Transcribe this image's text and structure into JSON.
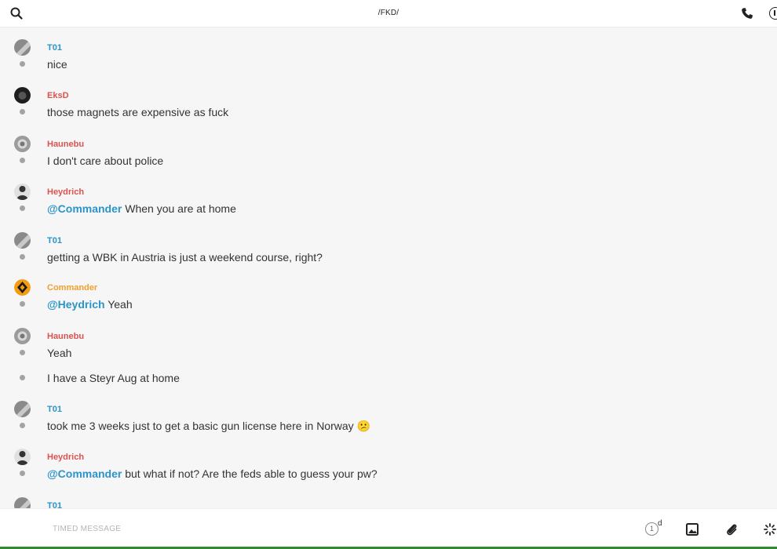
{
  "header": {
    "title": "/FKD/",
    "icons": [
      "search-icon",
      "phone-icon",
      "info-icon"
    ]
  },
  "colors": {
    "mention": "#2b94c8",
    "T01": "#2b94c8",
    "EksD": "#d9534f",
    "Haunebu": "#d9534f",
    "Heydrich": "#d9534f",
    "Commander": "#f0a02f"
  },
  "messages": [
    {
      "author": "T01",
      "text": "nice"
    },
    {
      "author": "EksD",
      "text": "those magnets are expensive as fuck"
    },
    {
      "author": "Haunebu",
      "text": "I don't care about police"
    },
    {
      "author": "Heydrich",
      "mention": "@Commander",
      "text": " When you are at home"
    },
    {
      "author": "T01",
      "text": "getting a WBK in Austria is just a weekend course, right?"
    },
    {
      "author": "Commander",
      "mention": "@Heydrich",
      "text": " Yeah"
    },
    {
      "author": "Haunebu",
      "text": "Yeah"
    },
    {
      "author": "",
      "text": "I have a Steyr Aug at home"
    },
    {
      "author": "T01",
      "text": "took me 3 weeks just to get a basic gun license here in Norway",
      "emoji": "😕"
    },
    {
      "author": "Heydrich",
      "mention": "@Commander",
      "text": " but what if not? Are the feds able to guess your pw?"
    },
    {
      "author": "T01",
      "text": ""
    }
  ],
  "composer": {
    "placeholder": "TIMED MESSAGE",
    "timer_value": "1",
    "timer_unit": "d",
    "icons": [
      "image-icon",
      "paperclip-icon",
      "loading-icon"
    ]
  }
}
